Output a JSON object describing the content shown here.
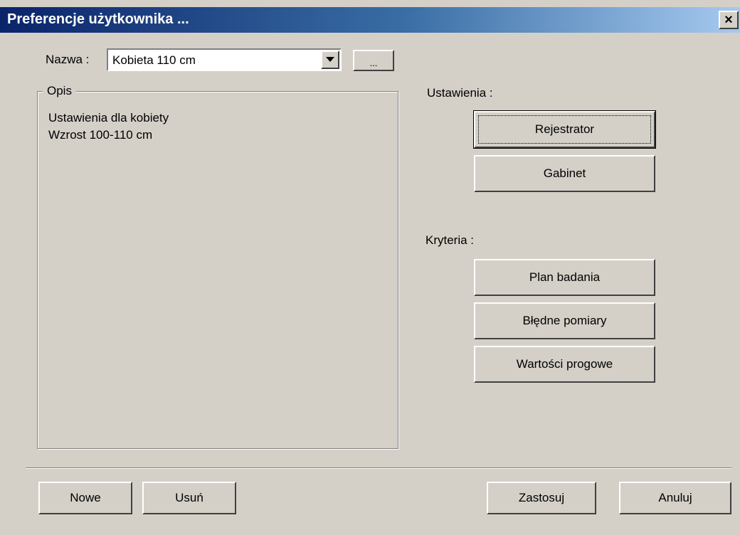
{
  "window": {
    "title": "Preferencje użytkownika ...",
    "close_label": "×"
  },
  "name_row": {
    "label": "Nazwa :",
    "selected_value": "Kobieta 110 cm",
    "browse_label": "..."
  },
  "description": {
    "legend": "Opis",
    "line1": "Ustawienia dla kobiety",
    "line2": "Wzrost  100-110 cm"
  },
  "settings": {
    "label": "Ustawienia :",
    "registrar_label": "Rejestrator",
    "office_label": "Gabinet"
  },
  "criteria": {
    "label": "Kryteria :",
    "plan_label": "Plan badania",
    "errors_label": "Błędne pomiary",
    "thresholds_label": "Wartości progowe"
  },
  "footer": {
    "new_label": "Nowe",
    "delete_label": "Usuń",
    "apply_label": "Zastosuj",
    "cancel_label": "Anuluj"
  },
  "colors": {
    "titlebar_start": "#0a246a",
    "titlebar_end": "#a6caf0",
    "face": "#d4d0c8"
  }
}
